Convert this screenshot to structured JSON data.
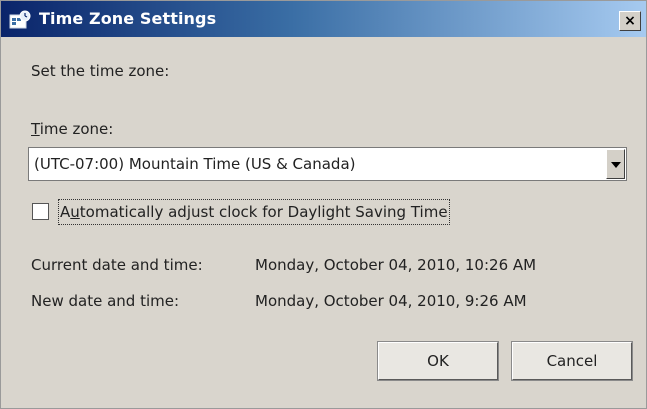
{
  "window": {
    "title": "Time Zone Settings",
    "close_glyph": "×"
  },
  "intro": "Set the time zone:",
  "timezone": {
    "label": "Time zone:",
    "mnemonic": "T",
    "label_rest": "ime zone:",
    "selected": "(UTC-07:00) Mountain Time (US & Canada)"
  },
  "dst": {
    "label_prefix": "A",
    "mnemonic": "u",
    "label_rest": "tomatically adjust clock for Daylight Saving Time",
    "checked": false
  },
  "times": {
    "current_label": "Current date and time:",
    "current_value": "Monday, October 04, 2010, 10:26 AM",
    "new_label": "New date and time:",
    "new_value": "Monday, October 04, 2010, 9:26 AM"
  },
  "buttons": {
    "ok": "OK",
    "cancel": "Cancel"
  },
  "icons": {
    "title": "clock-globe-icon",
    "close": "close-icon",
    "dropdown": "chevron-down-icon"
  }
}
